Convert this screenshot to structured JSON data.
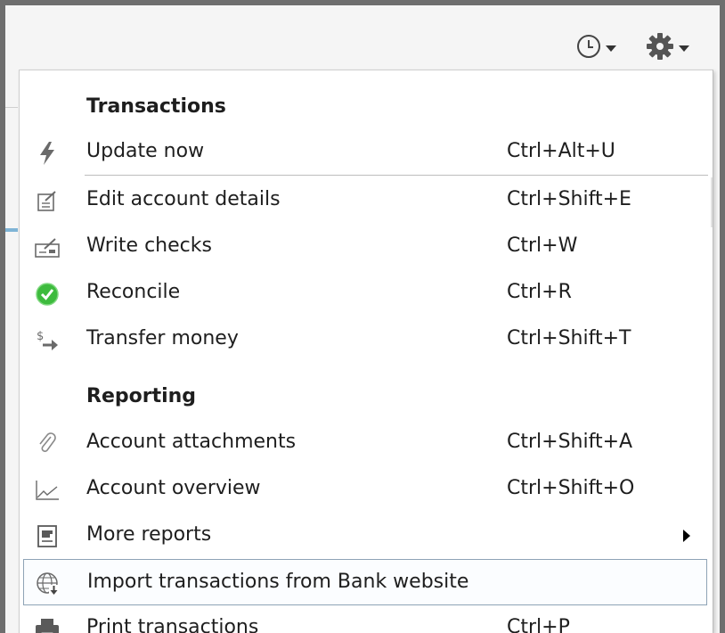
{
  "toolbar": {
    "clock_icon": "clock-icon",
    "gear_icon": "gear-icon"
  },
  "menu": {
    "sections": {
      "transactions": "Transactions",
      "reporting": "Reporting"
    },
    "items": [
      {
        "label": "Update now",
        "shortcut": "Ctrl+Alt+U",
        "icon": "lightning-icon"
      },
      {
        "label": "Edit account details",
        "shortcut": "Ctrl+Shift+E",
        "icon": "edit-note-icon"
      },
      {
        "label": "Write checks",
        "shortcut": "Ctrl+W",
        "icon": "check-writing-icon"
      },
      {
        "label": "Reconcile",
        "shortcut": "Ctrl+R",
        "icon": "reconcile-check-icon"
      },
      {
        "label": "Transfer money",
        "shortcut": "Ctrl+Shift+T",
        "icon": "transfer-money-icon"
      },
      {
        "label": "Account attachments",
        "shortcut": "Ctrl+Shift+A",
        "icon": "paperclip-icon"
      },
      {
        "label": "Account overview",
        "shortcut": "Ctrl+Shift+O",
        "icon": "line-chart-icon"
      },
      {
        "label": "More reports",
        "shortcut": "",
        "icon": "report-icon"
      },
      {
        "label": "Import transactions from Bank website",
        "shortcut": "",
        "icon": "globe-download-icon"
      },
      {
        "label": "Print transactions",
        "shortcut": "Ctrl+P",
        "icon": "printer-icon"
      }
    ]
  },
  "colors": {
    "reconcile_green": "#3dbb3d",
    "highlight_border": "#8ea3b6",
    "icon_gray": "#6a6a6a"
  }
}
